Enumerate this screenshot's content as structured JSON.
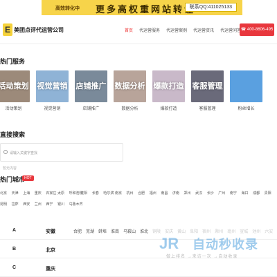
{
  "banner": {
    "left_text": "高效转化中",
    "middle_text": "更多高权重网站转让",
    "right_text": "联系QQ:411025133",
    "color": "#f7d44a"
  },
  "header": {
    "logo_glyph": "E",
    "brand": "美团点评代运营公司",
    "nav": [
      "首页",
      "代运营服务",
      "代运营案例",
      "代运营资讯",
      "代运营问答"
    ],
    "phone": "☎ 400-8606-495"
  },
  "services": {
    "title": "热门服务",
    "items": [
      {
        "overlay": "活动策划",
        "label": "活动策划",
        "bg": "#9c8a7a"
      },
      {
        "overlay": "视觉营销",
        "label": "视觉营销",
        "bg": "#8fb3d6"
      },
      {
        "overlay": "店铺推广",
        "label": "店铺推广",
        "bg": "#7a8a9a"
      },
      {
        "overlay": "数据分析",
        "label": "数据分析",
        "bg": "#b8a49a"
      },
      {
        "overlay": "爆款打造",
        "label": "爆款打造",
        "bg": "#c9b9c9"
      },
      {
        "overlay": "客服管理",
        "label": "客服管理",
        "bg": "#6a6a7a"
      },
      {
        "overlay": "",
        "label": "粉丝增长",
        "bg": "#5aa0e0"
      }
    ]
  },
  "search": {
    "title": "直接搜索",
    "placeholder": "请输入关键字查找",
    "empty": "暂无内容"
  },
  "cities": {
    "title": "热门城市",
    "badge": "HOT",
    "list": [
      "北京",
      "天津",
      "上海",
      "重庆",
      "石家庄",
      "太原",
      "呼和浩特",
      "沈阳",
      "长春",
      "哈尔滨",
      "南京",
      "杭州",
      "合肥",
      "福州",
      "南昌",
      "济南",
      "郑州",
      "武汉",
      "长沙",
      "广州",
      "南宁",
      "海口",
      "成都",
      "贵阳",
      "昆明",
      "拉萨",
      "西安",
      "兰州",
      "西宁",
      "银川",
      "乌鲁木齐"
    ]
  },
  "letters": [
    {
      "letter": "A",
      "province": "安徽",
      "cities": [
        "合肥",
        "芜湖",
        "蚌埠",
        "淮南",
        "马鞍山",
        "淮北",
        "铜陵",
        "安庆",
        "黄山",
        "阜阳",
        "宿州",
        "滁州",
        "亳州",
        "宣城",
        "池州",
        "六安"
      ]
    },
    {
      "letter": "B",
      "province": "北京",
      "cities": []
    },
    {
      "letter": "C",
      "province": "重庆",
      "cities": []
    }
  ],
  "watermark": {
    "logo": "JR",
    "text": "自动秒收录",
    "sub": "做上排名 →来访一次 →自动收录"
  }
}
